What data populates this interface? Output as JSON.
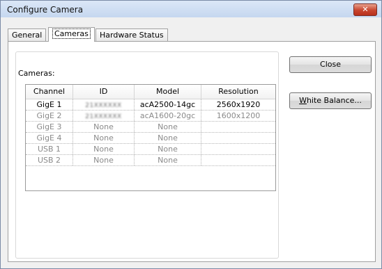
{
  "window": {
    "title": "Configure Camera",
    "close_glyph": "✕"
  },
  "tabs": [
    {
      "label": "General",
      "active": false
    },
    {
      "label": "Cameras",
      "active": true
    },
    {
      "label": "Hardware Status",
      "active": false
    }
  ],
  "cameras": {
    "label": "Cameras:",
    "columns": [
      "Channel",
      "ID",
      "Model",
      "Resolution"
    ],
    "rows": [
      {
        "channel": "GigE 1",
        "id": "21XXXXXX",
        "model": "acA2500-14gc",
        "resolution": "2560x1920",
        "enabled": true
      },
      {
        "channel": "GigE 2",
        "id": "21XXXXXX",
        "model": "acA1600-20gc",
        "resolution": "1600x1200",
        "enabled": false
      },
      {
        "channel": "GigE 3",
        "id": "None",
        "model": "None",
        "resolution": "",
        "enabled": false
      },
      {
        "channel": "GigE 4",
        "id": "None",
        "model": "None",
        "resolution": "",
        "enabled": false
      },
      {
        "channel": "USB 1",
        "id": "None",
        "model": "None",
        "resolution": "",
        "enabled": false
      },
      {
        "channel": "USB 2",
        "id": "None",
        "model": "None",
        "resolution": "",
        "enabled": false
      }
    ]
  },
  "buttons": {
    "close": "Close",
    "white_balance_underline": "W",
    "white_balance_rest": "hite Balance..."
  }
}
